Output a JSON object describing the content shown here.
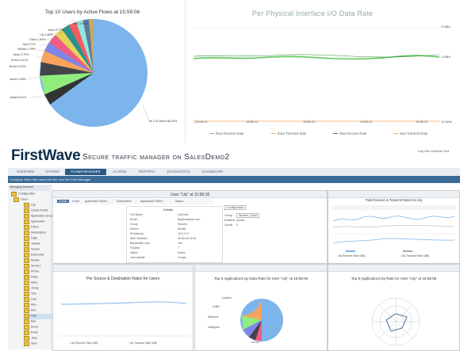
{
  "top_pie": {
    "title": "Top 10 Users by Active Flows at 15:59:06",
    "labels": [
      {
        "text": "Jack 1.67%"
      },
      {
        "text": "Jason 1.73%"
      },
      {
        "text": "Lily 1.88%"
      },
      {
        "text": "Olivia 1.89%"
      },
      {
        "text": "Jack 2.0%"
      },
      {
        "text": "William 1.99%"
      },
      {
        "text": "Jacky 3.79%"
      },
      {
        "text": "Emma 3.81%"
      },
      {
        "text": "Brook 4.43%"
      },
      {
        "text": "Jacob 4.55%"
      },
      {
        "text": "Jackie 6.61%"
      },
      {
        "text": "All 176 others 68.49%"
      }
    ]
  },
  "top_line": {
    "title": "Per Physical Interface I/O Data Rate",
    "y_ticks": [
      "5 MB/s",
      "1 MB/s",
      "10 KB/s"
    ],
    "x_ticks": [
      "15:59:12",
      "15:59:12",
      "15:59:32",
      "15:59:42",
      "15:59:52"
    ],
    "legend": [
      "Iface Receive Rate",
      "Iface Transmit Rate",
      "Max Receive Rate",
      "Max Transmit Rate"
    ]
  },
  "header": {
    "brand": "FirstWave",
    "subtitle": "Secure traffic manager on SalesDemo2",
    "user_link": "Log Out of Admin Tool",
    "tabs": [
      "OVERVIEW",
      "SYSTEM",
      "FLOWS MANAGER",
      "ALARMS",
      "REPORTS",
      "DIAGNOSTICS",
      "DASHBOARD"
    ],
    "crumb": "Configure flows that users will see over the Flow Manager"
  },
  "sidebar": {
    "header": "Managing Network",
    "items": [
      "Configuration",
      "Users",
      "Lily",
      "Oracle Profile",
      "Application Group",
      "Application",
      "Filters",
      "Workstation",
      "Daily",
      "Tablets",
      "Vendor",
      "Enterprise",
      "Mobile",
      "Servers",
      "Phone",
      "Ruby",
      "Mary",
      "Jenny",
      "Tom",
      "Lisa",
      "Alex",
      "Ann",
      "Kate",
      "Bob",
      "Elena",
      "Emily",
      "Jane",
      "Sara"
    ]
  },
  "panel_user": {
    "title": "User \"Lily\" at 11:58:18",
    "tabs": [
      "Details",
      "Flows",
      "Application Rules",
      "Subscribers",
      "Application Filters",
      "Status"
    ],
    "section": "Details",
    "rows": [
      {
        "k": "Full Name",
        "v": "Lily Rest"
      },
      {
        "k": "Email",
        "v": "lily@example.com"
      },
      {
        "k": "Group",
        "v": "Student"
      },
      {
        "k": "Device",
        "v": "Mobile"
      },
      {
        "k": "IP Address",
        "v": "10.0.3.17"
      },
      {
        "k": "MAC Address",
        "v": "00:a0:c9:14:c8"
      },
      {
        "k": "Bandwidth Limit",
        "v": "Yes"
      },
      {
        "k": "Policies",
        "v": "7"
      },
      {
        "k": "Status",
        "v": "Active"
      },
      {
        "k": "Last Update",
        "v": "7s ago"
      }
    ],
    "config_button": "Configuration",
    "group_label": "Group",
    "group_value": "Student_Class",
    "enabled_label": "Enabled",
    "enabled_value": "Quota",
    "quota_label": "Quota",
    "quota_value": "0"
  },
  "panel_rates": {
    "title": "Total Receive & Transmit Rates for Lily",
    "legend_left": "Lily Receive Rate (MB)",
    "legend_right": "Lily Transmit Rate (MB)"
  },
  "panel_bottom_left": {
    "title": "Per Source & Destination Rates for Users",
    "legend": [
      "Lily Receive Rate (MB)",
      "Lily Transmit Rate (MB)"
    ]
  },
  "panel_bottom_mid": {
    "title": "Top 5 Applications by Data Rate for User \"Lily\" at 15:59:06",
    "labels": [
      "youtube",
      "netflix",
      "facebook",
      "instagram",
      "Current"
    ]
  },
  "panel_bottom_right": {
    "title": "Top 5 Applications by Rate for User \"Lily\" at 15:59:06"
  }
}
